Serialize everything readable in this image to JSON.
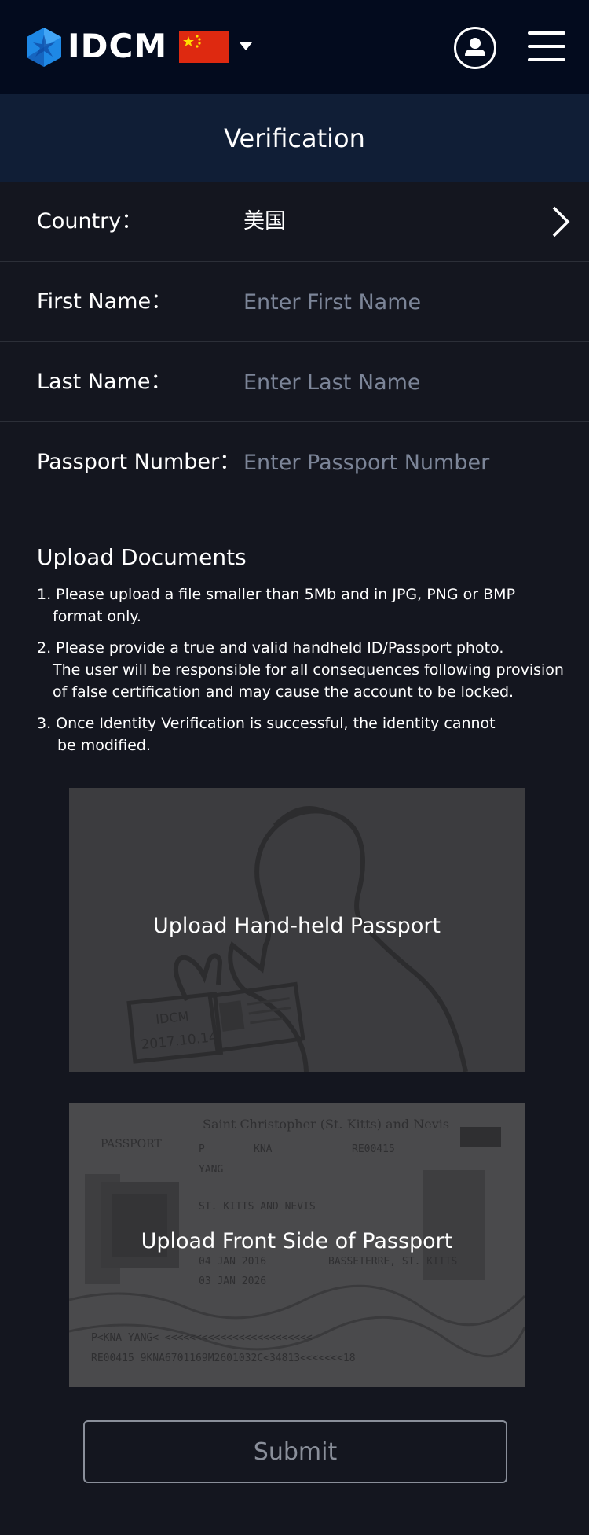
{
  "header": {
    "brand": "IDCM",
    "logo_icon": "hexagon-star-logo",
    "flag_icon": "china-flag-icon",
    "user_icon": "user-circle-icon",
    "menu_icon": "hamburger-menu-icon"
  },
  "page": {
    "title": "Verification"
  },
  "form": {
    "country": {
      "label": "Country：",
      "value": "美国"
    },
    "first_name": {
      "label": "First Name：",
      "placeholder": "Enter First Name"
    },
    "last_name": {
      "label": "Last Name：",
      "placeholder": "Enter Last Name"
    },
    "passport_number": {
      "label": "Passport Number：",
      "placeholder": "Enter Passport Number"
    }
  },
  "upload": {
    "heading": "Upload Documents",
    "notes": [
      {
        "line1": "1. Please upload a file smaller than 5Mb and in JPG, PNG or BMP",
        "line2": "format only."
      },
      {
        "line1": "2. Please provide a true and valid handheld ID/Passport photo.",
        "line2": "The user will be responsible for all consequences following provision",
        "line3": "of false certification and may cause the account to be locked."
      },
      {
        "line1": "3. Once Identity Verification is successful, the identity cannot",
        "line2": "be modified."
      }
    ],
    "handheld": {
      "caption": "Upload Hand-held Passport",
      "sample_card_text": "IDCM",
      "sample_card_date": "2017.10.14"
    },
    "front": {
      "caption": "Upload Front Side of Passport",
      "country_header": "Saint Christopher (St. Kitts) and Nevis",
      "doc_label": "PASSPORT",
      "type": "P",
      "code": "KNA",
      "number": "RE00415",
      "surname": "YANG",
      "nationality": "ST. KITTS AND NEVIS",
      "place": "BASSETERRE, ST. KITTS",
      "issue_date": "04 JAN 2016",
      "expiry_date": "03 JAN 2026",
      "mrz1": "P<KNA YANG<          <<<<<<<<<<<<<<<<<<<<<<<<",
      "mrz2": "RE00415   9KNA6701169M2601032C<34813<<<<<<<18"
    }
  },
  "actions": {
    "submit_label": "Submit"
  },
  "colors": {
    "background": "#14161f",
    "header": "#030b1e",
    "titlebar": "#101e36",
    "brand_blue": "#1e88e5"
  }
}
